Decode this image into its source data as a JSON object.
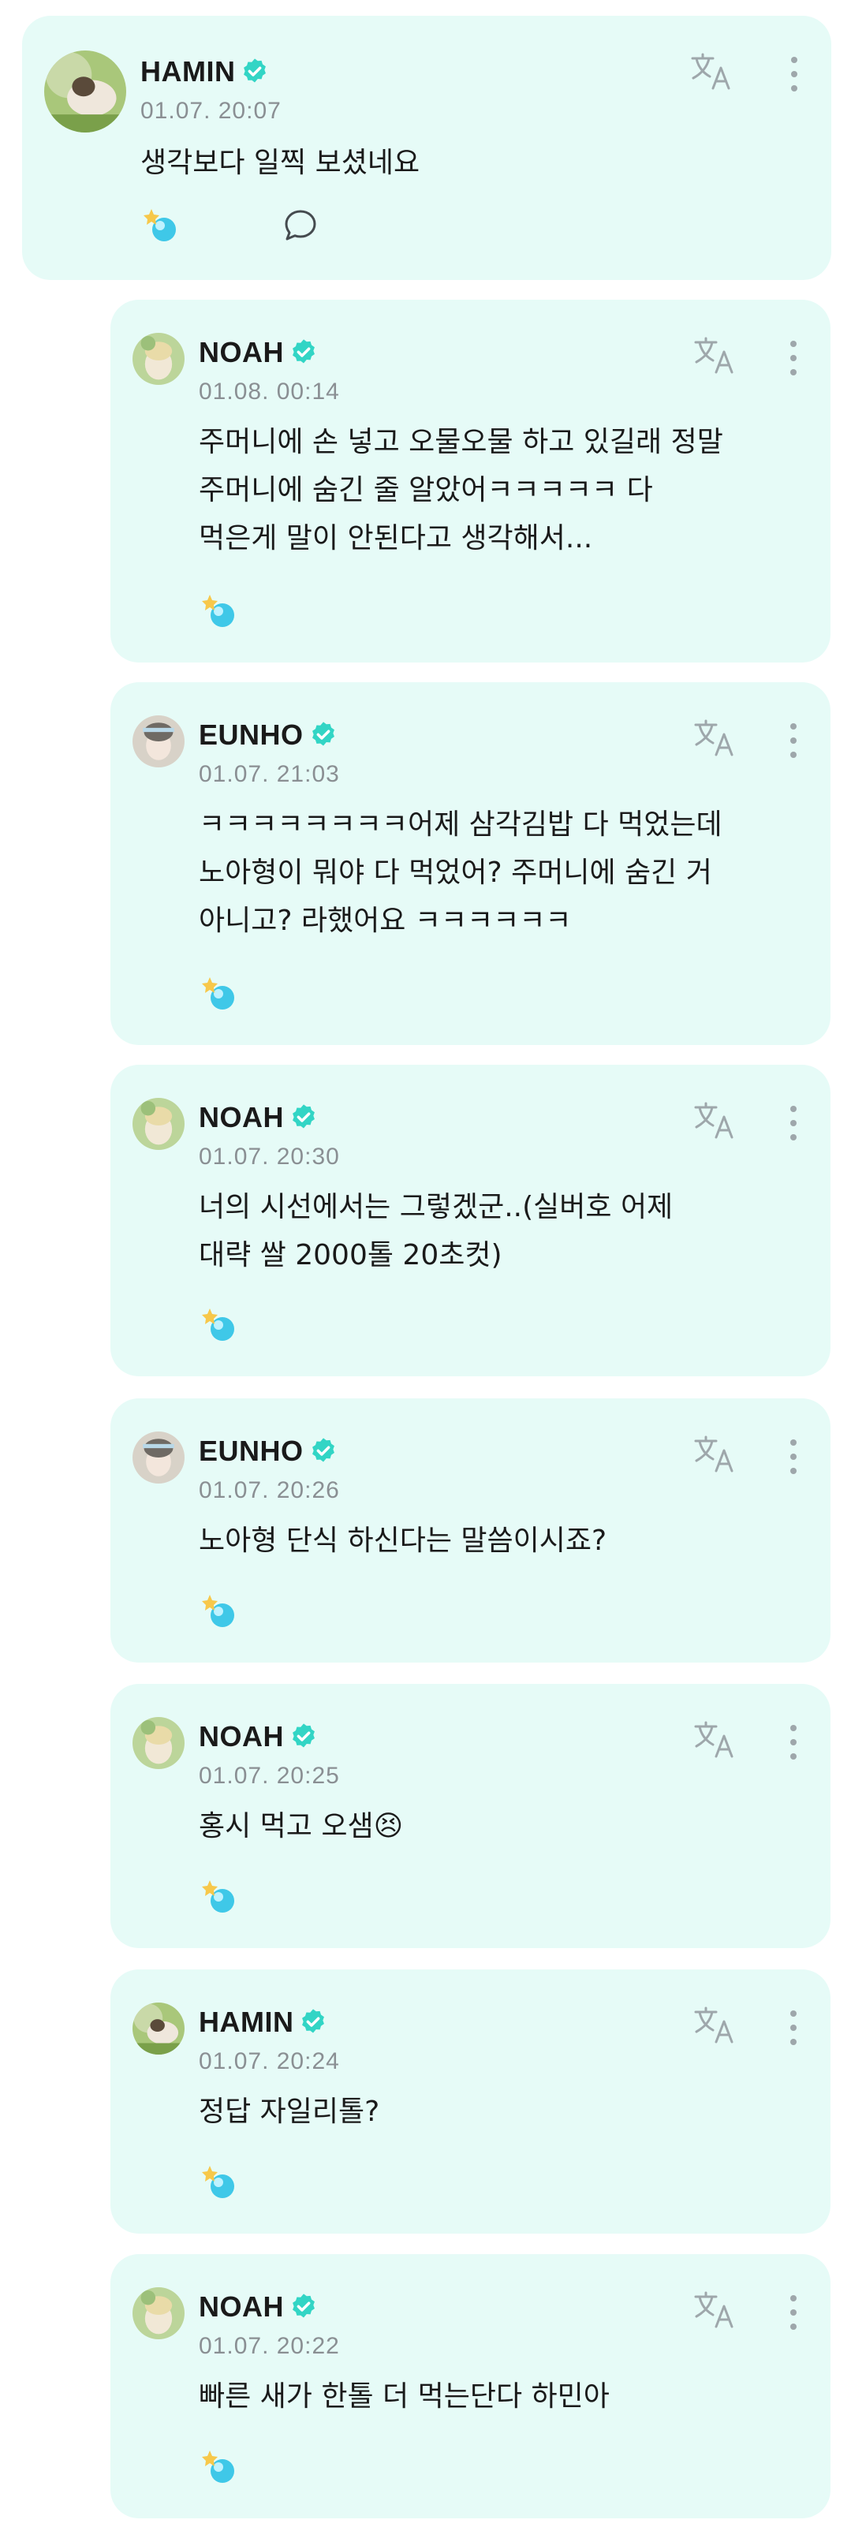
{
  "colors": {
    "card_background": "#e6fbf7",
    "verified_badge": "#32d5c5",
    "icon": "#9ea7ab",
    "name": "#1a1a1a",
    "timestamp": "#8a8f93"
  },
  "icons": {
    "verified": "verified-badge-icon",
    "translate": "translate-icon",
    "more": "more-vertical-icon",
    "reaction": "lightstick-reaction-icon",
    "comment": "comment-bubble-icon"
  },
  "post": {
    "author": "HAMIN",
    "timestamp": "01.07. 20:07",
    "content": "생각보다 일찍 보셨네요"
  },
  "replies": [
    {
      "author": "NOAH",
      "timestamp": "01.08. 00:14",
      "content": "주머니에 손 넣고 오물오물 하고 있길래 정말\n주머니에 숨긴 줄 알았어ㅋㅋㅋㅋㅋ 다\n먹은게 말이 안된다고 생각해서..."
    },
    {
      "author": "EUNHO",
      "timestamp": "01.07. 21:03",
      "content": "ㅋㅋㅋㅋㅋㅋㅋㅋ어제 삼각김밥 다 먹었는데\n노아형이 뭐야 다 먹었어? 주머니에 숨긴 거\n아니고? 라했어요 ㅋㅋㅋㅋㅋㅋ"
    },
    {
      "author": "NOAH",
      "timestamp": "01.07. 20:30",
      "content": "너의 시선에서는 그렇겠군..(실버호 어제\n대략 쌀 2000톨 20초컷)"
    },
    {
      "author": "EUNHO",
      "timestamp": "01.07. 20:26",
      "content": "노아형 단식 하신다는 말씀이시죠?"
    },
    {
      "author": "NOAH",
      "timestamp": "01.07. 20:25",
      "content": "홍시 먹고 오샘😣"
    },
    {
      "author": "HAMIN",
      "timestamp": "01.07. 20:24",
      "content": "정답 자일리톨?"
    },
    {
      "author": "NOAH",
      "timestamp": "01.07. 20:22",
      "content": "빠른 새가 한톨 더 먹는단다 하민아"
    }
  ]
}
